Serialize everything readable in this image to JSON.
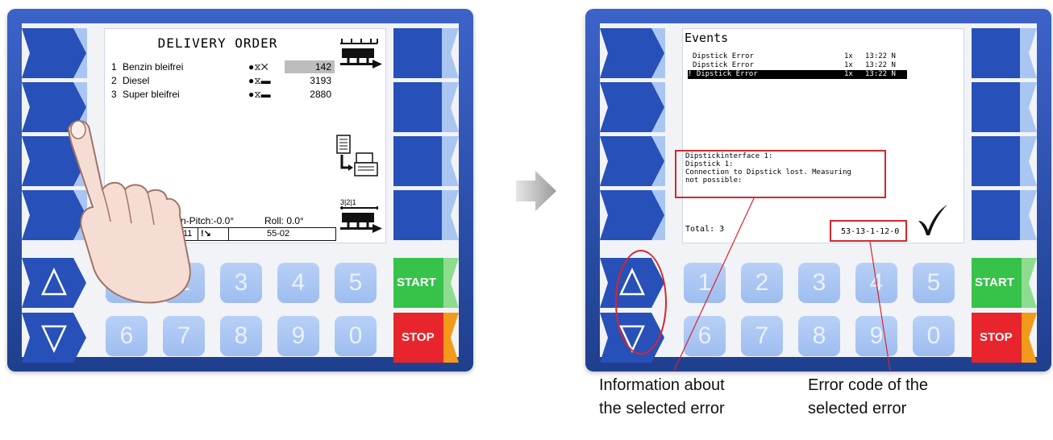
{
  "left_screen": {
    "title": "DELIVERY ORDER",
    "products": [
      {
        "num": "1",
        "name": "Benzin bleifrei",
        "status": "●⧖✕",
        "amount": "142",
        "highlight": true
      },
      {
        "num": "2",
        "name": "Diesel",
        "status": "●⧖▬",
        "amount": "3193",
        "highlight": false
      },
      {
        "num": "3",
        "name": "Super bleifrei",
        "status": "●⧖▬",
        "amount": "2880",
        "highlight": false
      }
    ],
    "pitch": "n-Pitch:-0.0°",
    "roll": "Roll: 0.0°",
    "status_bar": {
      "id": "11",
      "code": "55-02"
    },
    "compartment_labels": "3|2|1"
  },
  "right_screen": {
    "title": "Events",
    "events": [
      {
        "name": "Dipstick Error",
        "count": "1x",
        "time": "13:22 N",
        "selected": false
      },
      {
        "name": "Dipstick Error",
        "count": "1x",
        "time": "13:22 N",
        "selected": false
      },
      {
        "name": "! Dipstick Error",
        "count": "1x",
        "time": "13:22 N",
        "selected": true
      }
    ],
    "info_lines": [
      "Dipstickinterface 1:",
      "Dipstick 1:",
      "Connection to Dipstick lost. Measuring",
      "not possible:"
    ],
    "total": "Total: 3",
    "error_code": "53-13-1-12-0"
  },
  "keys": {
    "up": "△",
    "down": "▽",
    "row1": [
      "1",
      "2",
      "3",
      "4",
      "5"
    ],
    "row2": [
      "6",
      "7",
      "8",
      "9",
      "0"
    ],
    "start": "START",
    "stop": "STOP"
  },
  "annotations": {
    "info_caption_1": "Information about",
    "info_caption_2": "the selected error",
    "code_caption_1": "Error code of the",
    "code_caption_2": "selected error"
  },
  "colors": {
    "frame": "#2a4ea8",
    "softkey_light": "#a9c6f3",
    "softkey_dark": "#2750b8",
    "start": "#37c24a",
    "stop": "#e8242c",
    "stop_accent": "#f39a1a",
    "annotation": "#d7262e"
  }
}
